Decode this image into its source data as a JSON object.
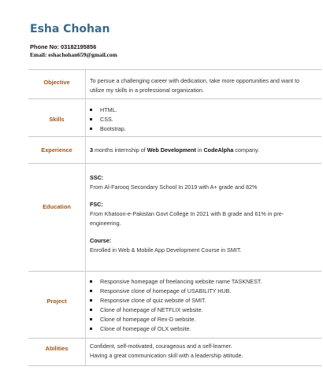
{
  "name": "Esha Chohan",
  "contact": {
    "phone_label": "Phone No:",
    "phone": "03182195856",
    "email_label": "Email:",
    "email": "eshachohan659@gmail.com"
  },
  "sections": {
    "objective": {
      "label": "Objective",
      "text": "To persue a challenging career with dedication, take more opportunities and want to utilize my skills in a professional organization."
    },
    "skills": {
      "label": "Skills",
      "items": [
        "HTML.",
        "CSS.",
        "Bootstrap."
      ]
    },
    "experience": {
      "label": "Experience",
      "duration": "3",
      "text_a": " months internship of ",
      "field": "Web Development",
      "text_b": " in ",
      "company": "CodeAlpha",
      "text_c": " company."
    },
    "education": {
      "label": "Education",
      "entries": [
        {
          "title": "SSC:",
          "text": "From Al-Farooq Secondary School In 2019 with A+ grade and 82%"
        },
        {
          "title": "FSC:",
          "text": "From Khatoon-e-Pakistan Govt College In 2021 with B grade and 61% in pre-engineering."
        },
        {
          "title": "Course:",
          "text": "Enrolled in Web & Mobile App Development Course in SMIT."
        }
      ]
    },
    "project": {
      "label": "Project",
      "items": [
        "Responsive homepage of freelancing website name TASKNEST.",
        "Responsive clone of homepage of USABILITY HUB.",
        "Responsive clone of quiz website of SMIT.",
        "Clone of homepage of NETFLIX website.",
        "Clone of homepage of Rex-D website.",
        "Clone of homepage of OLX website."
      ]
    },
    "abilities": {
      "label": "Abilities",
      "lines": [
        "Confident, self-motivated, courageous and a self-learner.",
        "Having a great communication skill with a leadership attitude."
      ]
    }
  }
}
